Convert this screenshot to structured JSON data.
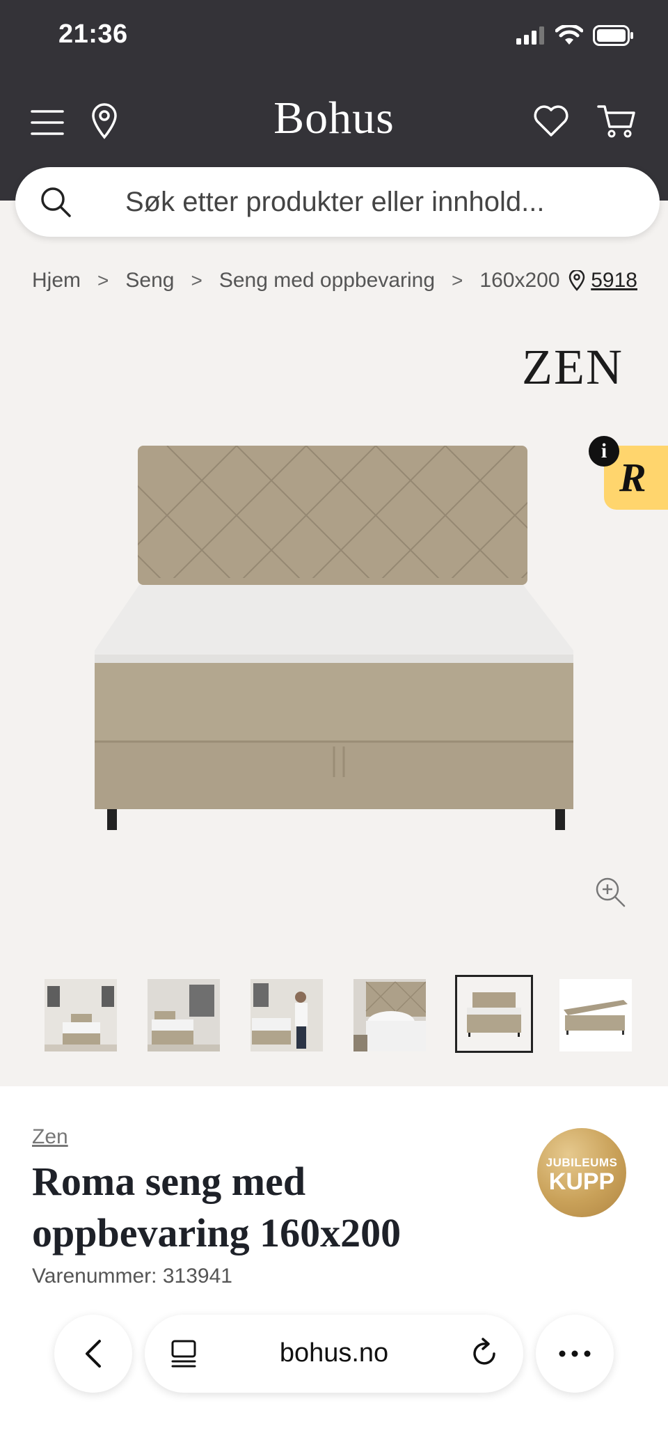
{
  "status_bar": {
    "time": "21:36"
  },
  "header": {
    "logo": "Bohus"
  },
  "search": {
    "placeholder": "Søk etter produkter eller innhold..."
  },
  "breadcrumb": {
    "items": [
      "Hjem",
      "Seng",
      "Seng med oppbevaring",
      "160x200"
    ],
    "separator": ">",
    "store_number": "5918"
  },
  "product_image": {
    "brand_logo": "ZEN"
  },
  "recommendation_badge": {
    "info": "i",
    "letter": "R"
  },
  "thumbnails": {
    "count": 6,
    "active_index": 4
  },
  "product": {
    "brand": "Zen",
    "title": "Roma seng med oppbevaring 160x200",
    "sku_label": "Varenummer: 313941",
    "badge_small": "JUBILEUMS",
    "badge_big": "KUPP"
  },
  "browser": {
    "url": "bohus.no"
  },
  "colors": {
    "header_bg": "#343338",
    "page_bg": "#f4f2f0",
    "badge_gold": "#c9a159",
    "reco_yellow": "#ffd56d"
  }
}
